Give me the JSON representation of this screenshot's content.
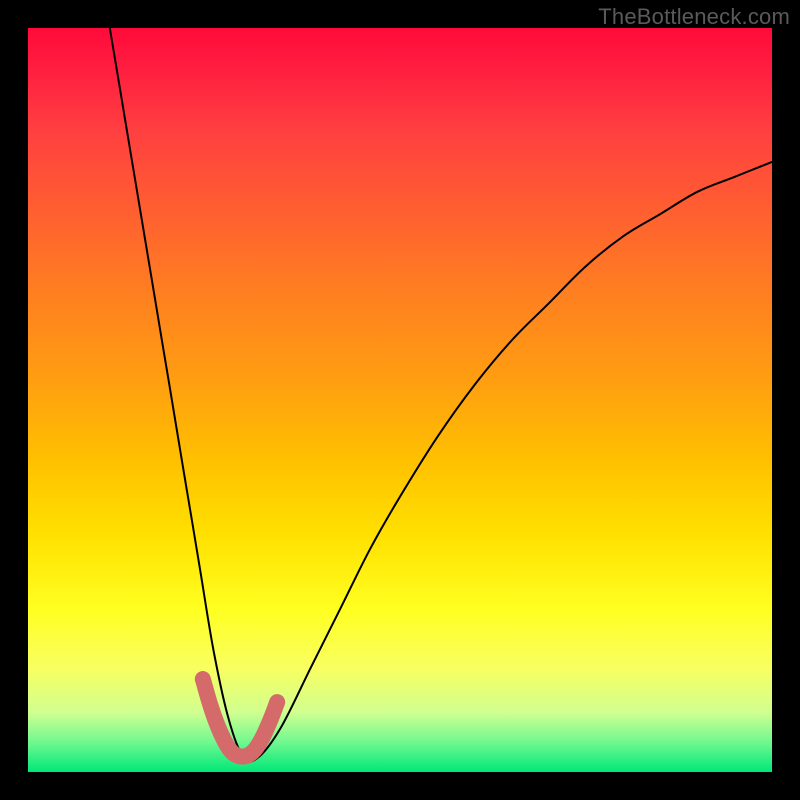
{
  "watermark": "TheBottleneck.com",
  "chart_data": {
    "type": "line",
    "title": "",
    "xlabel": "",
    "ylabel": "",
    "xlim": [
      0,
      100
    ],
    "ylim": [
      0,
      100
    ],
    "series": [
      {
        "name": "bottleneck-curve",
        "x": [
          11,
          13,
          15,
          17,
          19,
          21,
          23,
          25,
          27,
          29,
          31,
          34,
          38,
          42,
          46,
          50,
          55,
          60,
          65,
          70,
          75,
          80,
          85,
          90,
          95,
          100
        ],
        "values": [
          100,
          88,
          76,
          64,
          52,
          40,
          28,
          16,
          7,
          2,
          2,
          6,
          14,
          22,
          30,
          37,
          45,
          52,
          58,
          63,
          68,
          72,
          75,
          78,
          80,
          82
        ]
      }
    ],
    "highlight": {
      "color": "#d46a6a",
      "x": [
        23.5,
        24.5,
        25.5,
        26.5,
        27.5,
        28.5,
        29.5,
        30.5,
        31.5,
        32.5,
        33.5
      ],
      "values": [
        12.5,
        9.0,
        6.2,
        4.0,
        2.6,
        2.1,
        2.2,
        3.0,
        4.6,
        6.8,
        9.4
      ]
    }
  }
}
